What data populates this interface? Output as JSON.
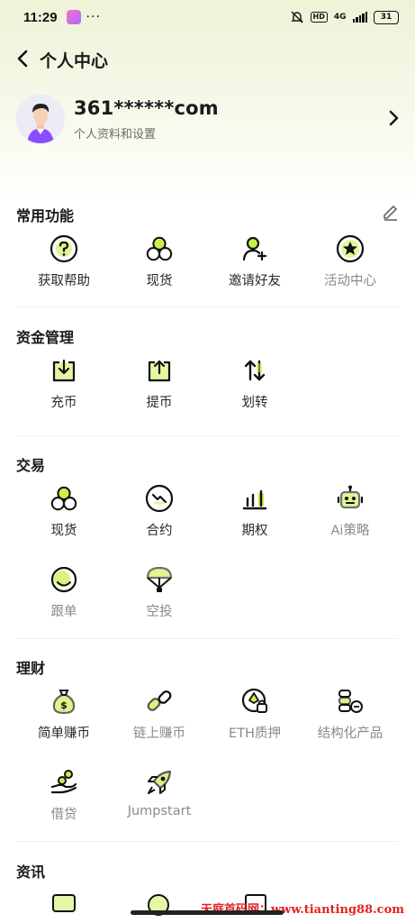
{
  "status_bar": {
    "time": "11:29",
    "network": "4G",
    "battery": "31"
  },
  "nav": {
    "title": "个人中心"
  },
  "profile": {
    "name": "361******com",
    "subtitle": "个人资料和设置"
  },
  "colors": {
    "accent": "#c8f04a",
    "text": "#1a1a1a",
    "muted": "#8a8a8a"
  },
  "sections": [
    {
      "title": "常用功能",
      "items": [
        {
          "label": "获取帮助",
          "icon": "question-icon"
        },
        {
          "label": "现货",
          "icon": "spot-icon"
        },
        {
          "label": "邀请好友",
          "icon": "invite-user-icon"
        },
        {
          "label": "活动中心",
          "icon": "star-badge-icon"
        }
      ]
    },
    {
      "title": "资金管理",
      "items": [
        {
          "label": "充币",
          "icon": "deposit-icon"
        },
        {
          "label": "提币",
          "icon": "withdraw-icon"
        },
        {
          "label": "划转",
          "icon": "transfer-icon"
        }
      ]
    },
    {
      "title": "交易",
      "items": [
        {
          "label": "现货",
          "icon": "spot-icon"
        },
        {
          "label": "合约",
          "icon": "futures-icon"
        },
        {
          "label": "期权",
          "icon": "options-chart-icon"
        },
        {
          "label": "Ai策略",
          "icon": "robot-icon"
        },
        {
          "label": "跟单",
          "icon": "copy-trade-icon"
        },
        {
          "label": "空投",
          "icon": "parachute-icon"
        }
      ]
    },
    {
      "title": "理财",
      "items": [
        {
          "label": "简单赚币",
          "icon": "money-bag-icon"
        },
        {
          "label": "链上赚币",
          "icon": "chain-link-icon"
        },
        {
          "label": "ETH质押",
          "icon": "eth-stake-icon"
        },
        {
          "label": "结构化产品",
          "icon": "coin-stack-icon"
        },
        {
          "label": "借贷",
          "icon": "loan-hand-icon"
        },
        {
          "label": "Jumpstart",
          "icon": "rocket-icon"
        }
      ]
    },
    {
      "title": "资讯",
      "items": []
    }
  ],
  "watermark": "天庭首码网：www.tianting88.com"
}
